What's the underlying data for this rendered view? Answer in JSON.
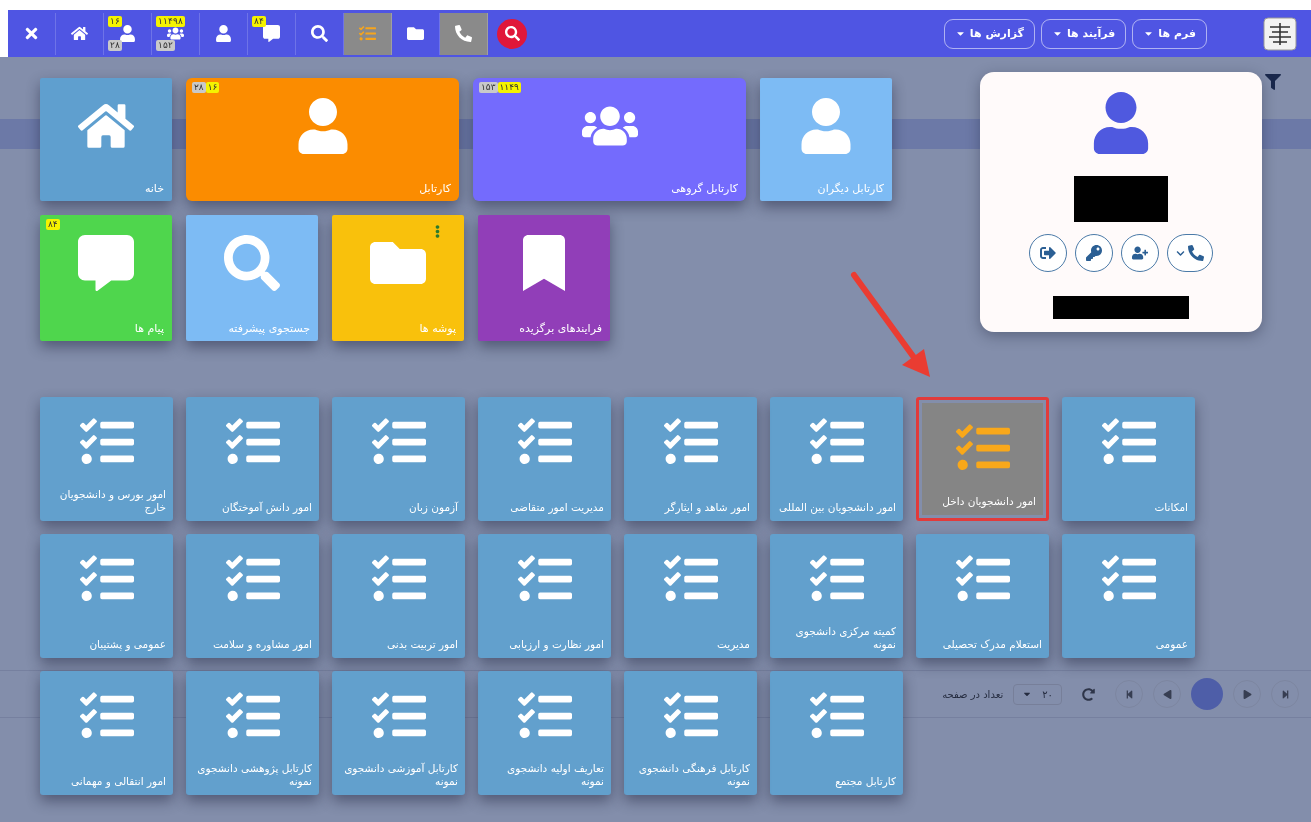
{
  "toolbar": [
    {
      "kind": "searchround",
      "active": false
    },
    {
      "kind": "phone",
      "active": true
    },
    {
      "kind": "folder",
      "active": false
    },
    {
      "kind": "tasks",
      "active": true
    },
    {
      "kind": "search",
      "active": false
    },
    {
      "kind": "messages",
      "active": false,
      "badges": [
        {
          "text": "۸۴",
          "kind": "new"
        }
      ]
    },
    {
      "kind": "person",
      "active": false
    },
    {
      "kind": "group",
      "active": false,
      "badges": [
        {
          "text": "۱۱۴۹۸",
          "kind": "new"
        },
        {
          "text": "۱۵۲",
          "kind": "total"
        }
      ]
    },
    {
      "kind": "inbox",
      "active": false,
      "badges": [
        {
          "text": "۱۶",
          "kind": "new"
        },
        {
          "text": "۲۸",
          "kind": "total"
        }
      ]
    },
    {
      "kind": "home",
      "active": false
    },
    {
      "kind": "close",
      "active": false
    }
  ],
  "menus": [
    {
      "label": "فرم ها"
    },
    {
      "label": "فرآیند ها"
    },
    {
      "label": "گزارش ها"
    }
  ],
  "pagination": {
    "page_size_label": "تعداد در صفحه",
    "page_size": "۲۰"
  },
  "shortcuts": [
    {
      "kind": "others",
      "label": "کارتابل دیگران",
      "wide": false,
      "color": "#7dbbf4"
    },
    {
      "kind": "group",
      "label": "کارتابل گروهی",
      "wide": true,
      "color": "#746bfd",
      "badges": [
        {
          "text": "۱۱۴۹",
          "kind": "new"
        },
        {
          "text": "۱۵۳",
          "kind": "total"
        }
      ]
    },
    {
      "kind": "inbox",
      "label": "کارتابل",
      "wide": true,
      "color": "#fb8c00",
      "badges": [
        {
          "text": "۱۶",
          "kind": "new"
        },
        {
          "text": "۲۸",
          "kind": "total"
        }
      ]
    },
    {
      "kind": "home",
      "label": "خانه",
      "wide": false,
      "color": "#5f9fcf"
    },
    {
      "kind": "favorites",
      "label": "فرایندهای برگزیده",
      "wide": false,
      "color": "#913eb8"
    },
    {
      "kind": "folders",
      "label": "پوشه ها",
      "wide": false,
      "color": "#f9c10c",
      "menu": true
    },
    {
      "kind": "search",
      "label": "جستجوی پیشرفته",
      "wide": false,
      "color": "#7dbbf4"
    },
    {
      "kind": "messages",
      "label": "پیام ها",
      "wide": false,
      "color": "#4fd64d",
      "badges": [
        {
          "text": "۸۴",
          "kind": "new"
        }
      ]
    }
  ],
  "profile": {
    "actions": [
      {
        "kind": "call"
      },
      {
        "kind": "adduser"
      },
      {
        "kind": "password"
      },
      {
        "kind": "logout"
      }
    ]
  },
  "modules": [
    {
      "label": "امکانات",
      "selected": false
    },
    {
      "label": "امور دانشجویان داخل",
      "selected": true
    },
    {
      "label": "امور دانشجویان بین المللی",
      "selected": false
    },
    {
      "label": "امور شاهد و ایثارگر",
      "selected": false
    },
    {
      "label": "مدیریت امور متقاضی",
      "selected": false
    },
    {
      "label": "آزمون زبان",
      "selected": false
    },
    {
      "label": "امور دانش آموختگان",
      "selected": false
    },
    {
      "label": "امور بورس و دانشجویان خارج",
      "selected": false
    },
    {
      "label": "عمومی",
      "selected": false
    },
    {
      "label": "استعلام مدرک تحصیلی",
      "selected": false
    },
    {
      "label": "کمیته مرکزی دانشجوی نمونه",
      "selected": false
    },
    {
      "label": "مدیریت",
      "selected": false
    },
    {
      "label": "امور نظارت و ارزیابی",
      "selected": false
    },
    {
      "label": "امور تربیت بدنی",
      "selected": false
    },
    {
      "label": "امور مشاوره و سلامت",
      "selected": false
    },
    {
      "label": "عمومی و پشتیبان",
      "selected": false
    },
    {
      "label": "کارتابل مجتمع",
      "selected": false
    },
    {
      "label": "کارتابل فرهنگی دانشجوی نمونه",
      "selected": false
    },
    {
      "label": "تعاریف اولیه دانشجوی نمونه",
      "selected": false
    },
    {
      "label": "کارتابل آموزشی دانشجوی نمونه",
      "selected": false
    },
    {
      "label": "کارتابل پژوهشی دانشجوی نمونه",
      "selected": false
    },
    {
      "label": "امور انتقالی و مهمانی",
      "selected": false
    }
  ]
}
